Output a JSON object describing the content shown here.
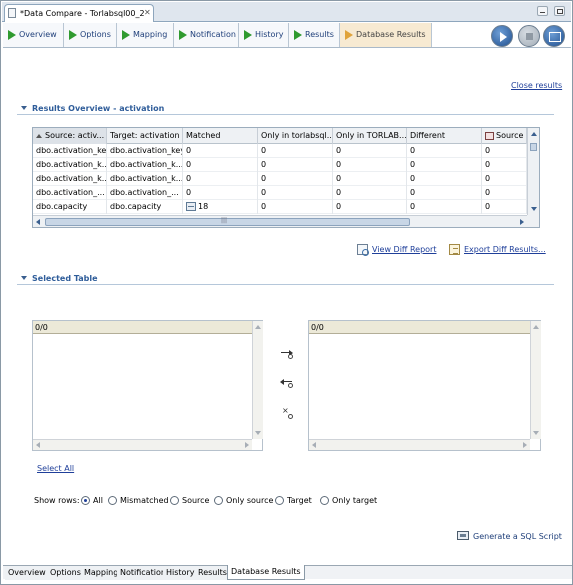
{
  "editor": {
    "tab_title": "*Data Compare - Torlabsql00_2",
    "close_glyph": "✕"
  },
  "page_tabs": [
    {
      "label": "Overview",
      "active": false
    },
    {
      "label": "Options",
      "active": false
    },
    {
      "label": "Mapping",
      "active": false
    },
    {
      "label": "Notification",
      "active": false
    },
    {
      "label": "History",
      "active": false
    },
    {
      "label": "Results",
      "active": false
    },
    {
      "label": "Database Results",
      "active": true
    }
  ],
  "toolbar": {
    "run_icon": "run-icon",
    "stop_icon": "stop-icon",
    "console_icon": "console-icon"
  },
  "close_results": "Close results",
  "results_overview": {
    "title": "Results Overview - activation",
    "columns": [
      "Source: activ...",
      "Target: activation",
      "Matched",
      "Only in torlabsql...",
      "Only in TORLAB...",
      "Different",
      "Source t"
    ],
    "rows": [
      [
        "dbo.activation_key",
        "dbo.activation_key",
        "0",
        "0",
        "0",
        "0",
        "0"
      ],
      [
        "dbo.activation_k...",
        "dbo.activation_k...",
        "0",
        "0",
        "0",
        "0",
        "0"
      ],
      [
        "dbo.activation_k...",
        "dbo.activation_k...",
        "0",
        "0",
        "0",
        "0",
        "0"
      ],
      [
        "dbo.activation_...",
        "dbo.activation_...",
        "0",
        "0",
        "0",
        "0",
        "0"
      ],
      [
        "dbo.capacity",
        "dbo.capacity",
        "18",
        "0",
        "0",
        "0",
        "0"
      ]
    ],
    "view_diff_report": "View Diff Report",
    "export_diff_results": "Export Diff Results..."
  },
  "selected_table": {
    "title": "Selected Table",
    "left_count": "0/0",
    "right_count": "0/0",
    "select_all": "Select All",
    "show_rows_label": "Show rows:",
    "show_rows_options": [
      {
        "label": "All",
        "checked": true
      },
      {
        "label": "Mismatched",
        "checked": false
      },
      {
        "label": "Source",
        "checked": false
      },
      {
        "label": "Only source",
        "checked": false
      },
      {
        "label": "Target",
        "checked": false
      },
      {
        "label": "Only target",
        "checked": false
      }
    ],
    "generate_sql": "Generate a SQL Script"
  },
  "bottom_tabs": [
    "Overview",
    "Options",
    "Mapping",
    "Notification",
    "History",
    "Results",
    "Database Results"
  ],
  "bottom_active": "Database Results",
  "colors": {
    "accent": "#1f3f7a",
    "section_title": "#2f5d9a",
    "active_tab_bg": "#f7ead2"
  }
}
